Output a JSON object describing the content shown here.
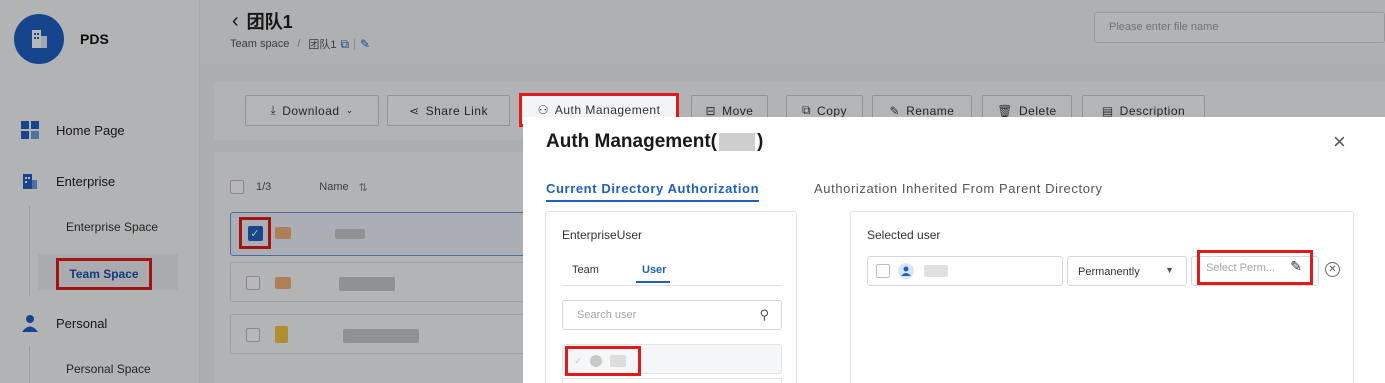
{
  "app": {
    "name": "PDS"
  },
  "sidebar": {
    "items": [
      {
        "label": "Home Page"
      },
      {
        "label": "Enterprise"
      },
      {
        "label": "Enterprise Space"
      },
      {
        "label": "Team Space"
      },
      {
        "label": "Personal"
      },
      {
        "label": "Personal Space"
      }
    ]
  },
  "header": {
    "back_icon": "‹",
    "title": "团队1",
    "breadcrumb": {
      "root": "Team space",
      "separator": "/",
      "current": "团队1",
      "divider": "|"
    },
    "search_placeholder": "Please enter file name"
  },
  "toolbar": {
    "buttons": [
      {
        "label": "Download",
        "icon": "download-icon"
      },
      {
        "label": "Share Link",
        "icon": "share-icon"
      },
      {
        "label": "Auth Management",
        "icon": "auth-icon"
      },
      {
        "label": "Move",
        "icon": "move-icon"
      },
      {
        "label": "Copy",
        "icon": "copy-icon"
      },
      {
        "label": "Rename",
        "icon": "rename-icon"
      },
      {
        "label": "Delete",
        "icon": "delete-icon"
      },
      {
        "label": "Description",
        "icon": "description-icon"
      }
    ]
  },
  "file_list": {
    "selected_count": "1/3",
    "name_header": "Name",
    "sort_icon": "⇅"
  },
  "modal": {
    "title_prefix": "Auth Management(",
    "title_suffix": ")",
    "close_icon": "×",
    "tabs": [
      {
        "label": "Current Directory Authorization",
        "active": true
      },
      {
        "label": "Authorization Inherited From Parent Directory",
        "active": false
      }
    ],
    "left_panel": {
      "title": "EnterpriseUser",
      "subtabs": [
        {
          "label": "Team",
          "active": false
        },
        {
          "label": "User",
          "active": true
        }
      ],
      "search_placeholder": "Search user"
    },
    "right_panel": {
      "title": "Selected user",
      "duration_value": "Permanently",
      "permission_placeholder": "Select Perm..."
    }
  },
  "colors": {
    "accent": "#1f5fc4",
    "highlight": "#e01b1b"
  }
}
